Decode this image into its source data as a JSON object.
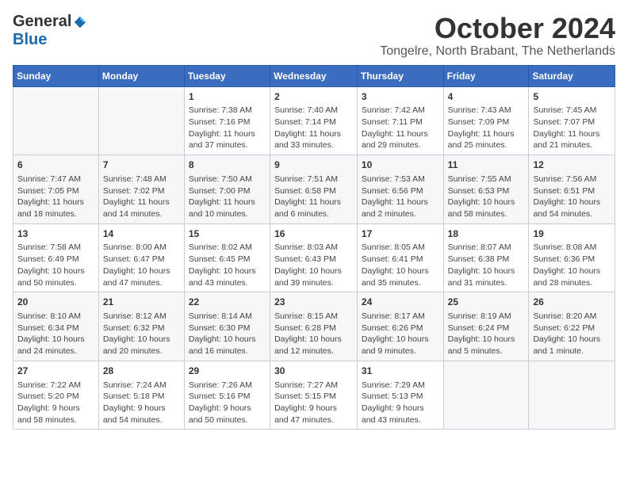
{
  "header": {
    "logo_general": "General",
    "logo_blue": "Blue",
    "month_title": "October 2024",
    "location": "Tongelre, North Brabant, The Netherlands"
  },
  "days_of_week": [
    "Sunday",
    "Monday",
    "Tuesday",
    "Wednesday",
    "Thursday",
    "Friday",
    "Saturday"
  ],
  "weeks": [
    [
      {
        "day": "",
        "info": ""
      },
      {
        "day": "",
        "info": ""
      },
      {
        "day": "1",
        "info": "Sunrise: 7:38 AM\nSunset: 7:16 PM\nDaylight: 11 hours and 37 minutes."
      },
      {
        "day": "2",
        "info": "Sunrise: 7:40 AM\nSunset: 7:14 PM\nDaylight: 11 hours and 33 minutes."
      },
      {
        "day": "3",
        "info": "Sunrise: 7:42 AM\nSunset: 7:11 PM\nDaylight: 11 hours and 29 minutes."
      },
      {
        "day": "4",
        "info": "Sunrise: 7:43 AM\nSunset: 7:09 PM\nDaylight: 11 hours and 25 minutes."
      },
      {
        "day": "5",
        "info": "Sunrise: 7:45 AM\nSunset: 7:07 PM\nDaylight: 11 hours and 21 minutes."
      }
    ],
    [
      {
        "day": "6",
        "info": "Sunrise: 7:47 AM\nSunset: 7:05 PM\nDaylight: 11 hours and 18 minutes."
      },
      {
        "day": "7",
        "info": "Sunrise: 7:48 AM\nSunset: 7:02 PM\nDaylight: 11 hours and 14 minutes."
      },
      {
        "day": "8",
        "info": "Sunrise: 7:50 AM\nSunset: 7:00 PM\nDaylight: 11 hours and 10 minutes."
      },
      {
        "day": "9",
        "info": "Sunrise: 7:51 AM\nSunset: 6:58 PM\nDaylight: 11 hours and 6 minutes."
      },
      {
        "day": "10",
        "info": "Sunrise: 7:53 AM\nSunset: 6:56 PM\nDaylight: 11 hours and 2 minutes."
      },
      {
        "day": "11",
        "info": "Sunrise: 7:55 AM\nSunset: 6:53 PM\nDaylight: 10 hours and 58 minutes."
      },
      {
        "day": "12",
        "info": "Sunrise: 7:56 AM\nSunset: 6:51 PM\nDaylight: 10 hours and 54 minutes."
      }
    ],
    [
      {
        "day": "13",
        "info": "Sunrise: 7:58 AM\nSunset: 6:49 PM\nDaylight: 10 hours and 50 minutes."
      },
      {
        "day": "14",
        "info": "Sunrise: 8:00 AM\nSunset: 6:47 PM\nDaylight: 10 hours and 47 minutes."
      },
      {
        "day": "15",
        "info": "Sunrise: 8:02 AM\nSunset: 6:45 PM\nDaylight: 10 hours and 43 minutes."
      },
      {
        "day": "16",
        "info": "Sunrise: 8:03 AM\nSunset: 6:43 PM\nDaylight: 10 hours and 39 minutes."
      },
      {
        "day": "17",
        "info": "Sunrise: 8:05 AM\nSunset: 6:41 PM\nDaylight: 10 hours and 35 minutes."
      },
      {
        "day": "18",
        "info": "Sunrise: 8:07 AM\nSunset: 6:38 PM\nDaylight: 10 hours and 31 minutes."
      },
      {
        "day": "19",
        "info": "Sunrise: 8:08 AM\nSunset: 6:36 PM\nDaylight: 10 hours and 28 minutes."
      }
    ],
    [
      {
        "day": "20",
        "info": "Sunrise: 8:10 AM\nSunset: 6:34 PM\nDaylight: 10 hours and 24 minutes."
      },
      {
        "day": "21",
        "info": "Sunrise: 8:12 AM\nSunset: 6:32 PM\nDaylight: 10 hours and 20 minutes."
      },
      {
        "day": "22",
        "info": "Sunrise: 8:14 AM\nSunset: 6:30 PM\nDaylight: 10 hours and 16 minutes."
      },
      {
        "day": "23",
        "info": "Sunrise: 8:15 AM\nSunset: 6:28 PM\nDaylight: 10 hours and 12 minutes."
      },
      {
        "day": "24",
        "info": "Sunrise: 8:17 AM\nSunset: 6:26 PM\nDaylight: 10 hours and 9 minutes."
      },
      {
        "day": "25",
        "info": "Sunrise: 8:19 AM\nSunset: 6:24 PM\nDaylight: 10 hours and 5 minutes."
      },
      {
        "day": "26",
        "info": "Sunrise: 8:20 AM\nSunset: 6:22 PM\nDaylight: 10 hours and 1 minute."
      }
    ],
    [
      {
        "day": "27",
        "info": "Sunrise: 7:22 AM\nSunset: 5:20 PM\nDaylight: 9 hours and 58 minutes."
      },
      {
        "day": "28",
        "info": "Sunrise: 7:24 AM\nSunset: 5:18 PM\nDaylight: 9 hours and 54 minutes."
      },
      {
        "day": "29",
        "info": "Sunrise: 7:26 AM\nSunset: 5:16 PM\nDaylight: 9 hours and 50 minutes."
      },
      {
        "day": "30",
        "info": "Sunrise: 7:27 AM\nSunset: 5:15 PM\nDaylight: 9 hours and 47 minutes."
      },
      {
        "day": "31",
        "info": "Sunrise: 7:29 AM\nSunset: 5:13 PM\nDaylight: 9 hours and 43 minutes."
      },
      {
        "day": "",
        "info": ""
      },
      {
        "day": "",
        "info": ""
      }
    ]
  ]
}
